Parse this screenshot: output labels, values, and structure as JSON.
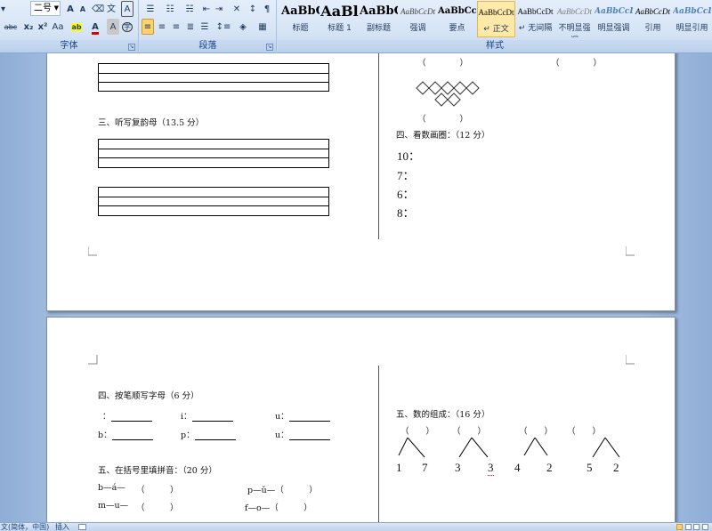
{
  "ribbon": {
    "font_group": {
      "label": "字体",
      "font_size": "二号",
      "grow_font": "A",
      "shrink_font": "A",
      "clear_format": "Aa",
      "strikethrough": "abc",
      "subscript": "x₂",
      "superscript": "x²",
      "change_case": "Aa",
      "highlight": "ab",
      "font_color": "A",
      "char_shading": "A",
      "enclose_char": "字"
    },
    "paragraph_group": {
      "label": "段落"
    },
    "styles_group": {
      "label": "样式"
    },
    "styles": [
      {
        "sample": "AaBbC",
        "name": "标题",
        "sample_size": "13px",
        "bold": true,
        "color": "#000000"
      },
      {
        "sample": "AaBl",
        "name": "标题 1",
        "sample_size": "16px",
        "bold": true,
        "color": "#000000"
      },
      {
        "sample": "AaBbC",
        "name": "副标题",
        "sample_size": "13px",
        "bold": true,
        "color": "#000000"
      },
      {
        "sample": "AaBbCcDt",
        "name": "强调",
        "sample_size": "9px",
        "bold": false,
        "italic": true,
        "color": "#444444"
      },
      {
        "sample": "AaBbCcD",
        "name": "要点",
        "sample_size": "10px",
        "bold": true,
        "color": "#000000"
      },
      {
        "sample": "AaBbCcDt",
        "name": "↵ 正文",
        "sample_size": "9px",
        "bold": false,
        "color": "#000000",
        "selected": true
      },
      {
        "sample": "AaBbCcDt",
        "name": "↵ 无间隔",
        "sample_size": "9px",
        "bold": false,
        "color": "#000000"
      },
      {
        "sample": "AaBbCcDt",
        "name": "不明显强调",
        "sample_size": "9px",
        "bold": false,
        "italic": true,
        "color": "#7f7f7f"
      },
      {
        "sample": "AaBbCcDt",
        "name": "明显强调",
        "sample_size": "9px",
        "bold": true,
        "italic": true,
        "color": "#4f81bd"
      },
      {
        "sample": "AaBbCcDt",
        "name": "引用",
        "sample_size": "9px",
        "bold": false,
        "italic": true,
        "color": "#000000"
      },
      {
        "sample": "AaBbCcDt",
        "name": "明显引用",
        "sample_size": "9px",
        "bold": true,
        "italic": true,
        "color": "#4f81bd"
      }
    ]
  },
  "page1": {
    "section3_title": "三、听写复韵母（13.5 分）",
    "hearts": "♡♡♡♡♡",
    "stars": "☆☆☆☆",
    "paren_blank": "（　　　　）",
    "section4_title": "四、看数画圈：（12 分）",
    "count_items": [
      "10：",
      "7：",
      "6：",
      "8："
    ]
  },
  "page2": {
    "section4b_title": "四、按笔顺写字母（6 分）",
    "letter_rows": [
      [
        "：",
        "i：",
        "u："
      ],
      [
        "b：",
        "p：",
        "u："
      ]
    ],
    "section5_title": "五、在括号里填拼音：（20 分）",
    "pinyin_rows": [
      {
        "left": "b—á—",
        "left_paren": "（　　　）",
        "right": "p—ǔ—（　　　）"
      },
      {
        "left": "m—u—",
        "left_paren": "（　　　）",
        "right": "f—o—（　　　）"
      }
    ],
    "section5b_title": "五、数的组成：（16 分）",
    "decomp_parens": [
      "（　　）",
      "（　　）",
      "（　　）",
      "（　　）"
    ],
    "decomp_numbers": [
      "1",
      "7",
      "3",
      "3",
      "4",
      "2",
      "5",
      "2"
    ]
  },
  "status_bar": {
    "language": "文(简体，中国)",
    "insert_mode": "插入"
  }
}
